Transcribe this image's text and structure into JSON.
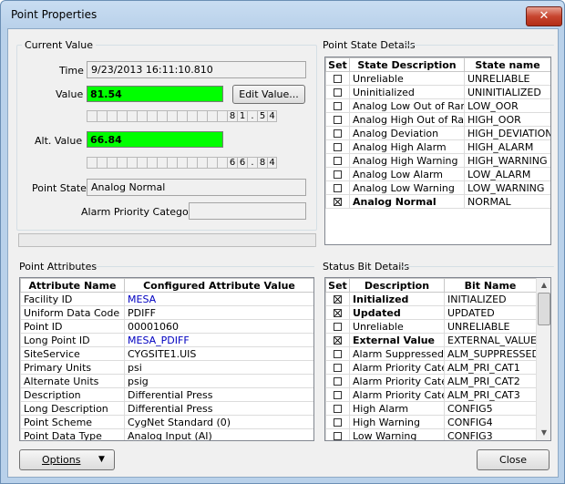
{
  "window": {
    "title": "Point Properties",
    "close_glyph": "✕"
  },
  "current_value": {
    "group_label": "Current Value",
    "time_label": "Time",
    "time_value": "9/23/2013 16:11:10.810",
    "value_label": "Value",
    "value": "81.54",
    "edit_button": "Edit Value...",
    "value_digits": [
      "",
      "",
      "",
      "",
      "",
      "",
      "",
      "",
      "",
      "",
      "",
      "",
      "",
      "",
      "8",
      "1",
      ".",
      "5",
      "4"
    ],
    "alt_label": "Alt. Value",
    "alt_value": "66.84",
    "alt_digits": [
      "",
      "",
      "",
      "",
      "",
      "",
      "",
      "",
      "",
      "",
      "",
      "",
      "",
      "",
      "6",
      "6",
      ".",
      "8",
      "4"
    ],
    "point_state_label": "Point State",
    "point_state_value": "Analog Normal",
    "alarm_priority_label": "Alarm Priority Category",
    "alarm_priority_value": ""
  },
  "point_state_details": {
    "group_label": "Point State Details",
    "columns": [
      "Set",
      "State Description",
      "State name"
    ],
    "rows": [
      {
        "checked": false,
        "bold": false,
        "description": "Unreliable",
        "name": "UNRELIABLE"
      },
      {
        "checked": false,
        "bold": false,
        "description": "Uninitialized",
        "name": "UNINITIALIZED"
      },
      {
        "checked": false,
        "bold": false,
        "description": "Analog Low Out of Range",
        "name": "LOW_OOR"
      },
      {
        "checked": false,
        "bold": false,
        "description": "Analog High Out of Range",
        "name": "HIGH_OOR"
      },
      {
        "checked": false,
        "bold": false,
        "description": "Analog Deviation",
        "name": "HIGH_DEVIATION"
      },
      {
        "checked": false,
        "bold": false,
        "description": "Analog High Alarm",
        "name": "HIGH_ALARM"
      },
      {
        "checked": false,
        "bold": false,
        "description": "Analog High Warning",
        "name": "HIGH_WARNING"
      },
      {
        "checked": false,
        "bold": false,
        "description": "Analog Low Alarm",
        "name": "LOW_ALARM"
      },
      {
        "checked": false,
        "bold": false,
        "description": "Analog Low Warning",
        "name": "LOW_WARNING"
      },
      {
        "checked": true,
        "bold": true,
        "description": "Analog Normal",
        "name": "NORMAL"
      }
    ]
  },
  "point_attributes": {
    "group_label": "Point Attributes",
    "columns": [
      "Attribute Name",
      "Configured Attribute Value"
    ],
    "rows": [
      {
        "name": "Facility ID",
        "value": "MESA",
        "link": true
      },
      {
        "name": "Uniform Data Code",
        "value": "PDIFF",
        "link": false
      },
      {
        "name": "Point ID",
        "value": "00001060",
        "link": false
      },
      {
        "name": "Long Point ID",
        "value": "MESA_PDIFF",
        "link": true
      },
      {
        "name": "SiteService",
        "value": "CYGSITE1.UIS",
        "link": false
      },
      {
        "name": "Primary Units",
        "value": "psi",
        "link": false
      },
      {
        "name": "Alternate Units",
        "value": "psig",
        "link": false
      },
      {
        "name": "Description",
        "value": "Differential Press",
        "link": false
      },
      {
        "name": "Long Description",
        "value": "Differential Press",
        "link": false
      },
      {
        "name": "Point Scheme",
        "value": "CygNet Standard (0)",
        "link": false
      },
      {
        "name": "Point Data Type",
        "value": "Analog Input (AI)",
        "link": false
      }
    ],
    "link_color": "#0000c0"
  },
  "status_bit_details": {
    "group_label": "Status Bit Details",
    "columns": [
      "Set",
      "Description",
      "Bit Name"
    ],
    "rows": [
      {
        "checked": true,
        "bold": true,
        "description": "Initialized",
        "name": "INITIALIZED"
      },
      {
        "checked": true,
        "bold": true,
        "description": "Updated",
        "name": "UPDATED"
      },
      {
        "checked": false,
        "bold": false,
        "description": "Unreliable",
        "name": "UNRELIABLE"
      },
      {
        "checked": true,
        "bold": true,
        "description": "External Value",
        "name": "EXTERNAL_VALUE"
      },
      {
        "checked": false,
        "bold": false,
        "description": "Alarm Suppressed",
        "name": "ALM_SUPPRESSED"
      },
      {
        "checked": false,
        "bold": false,
        "description": "Alarm Priority Category",
        "name": "ALM_PRI_CAT1"
      },
      {
        "checked": false,
        "bold": false,
        "description": "Alarm Priority Category",
        "name": "ALM_PRI_CAT2"
      },
      {
        "checked": false,
        "bold": false,
        "description": "Alarm Priority Category",
        "name": "ALM_PRI_CAT3"
      },
      {
        "checked": false,
        "bold": false,
        "description": "High Alarm",
        "name": "CONFIG5"
      },
      {
        "checked": false,
        "bold": false,
        "description": "High Warning",
        "name": "CONFIG4"
      },
      {
        "checked": false,
        "bold": false,
        "description": "Low Warning",
        "name": "CONFIG3"
      }
    ]
  },
  "footer": {
    "options_button": "Options",
    "close_button": "Close"
  },
  "colors": {
    "green_value": "#00ff00",
    "title_bg": "#b9d1ea",
    "close_red": "#c7452f"
  }
}
